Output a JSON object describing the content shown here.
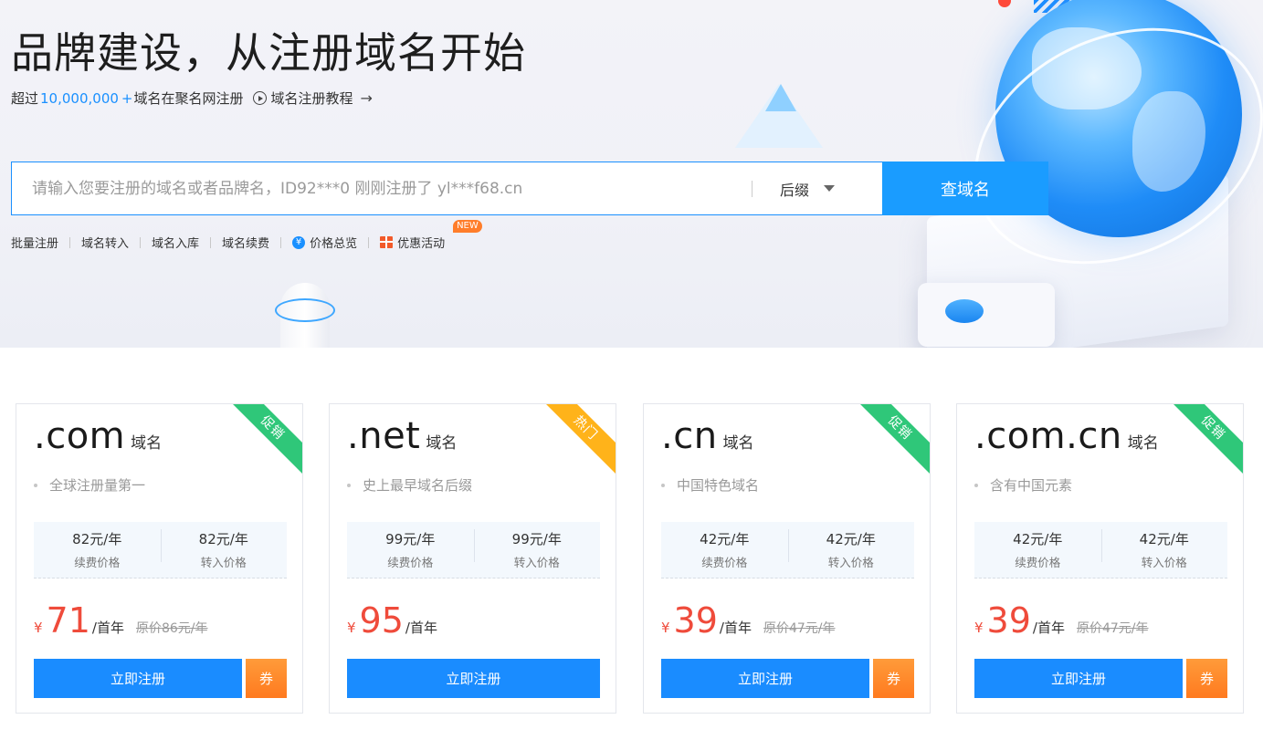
{
  "hero": {
    "title": "品牌建设，从注册域名开始",
    "sub_prefix": "超过",
    "sub_count": "10,000,000",
    "sub_plus": "+",
    "sub_suffix": "域名在聚名网注册",
    "tutorial_label": "域名注册教程",
    "arrow": "→"
  },
  "search": {
    "placeholder": "请输入您要注册的域名或者品牌名，ID92***0 刚刚注册了 yl***f68.cn",
    "suffix_label": "后缀",
    "button_label": "查域名"
  },
  "quick_links": {
    "batch": "批量注册",
    "transfer_in": "域名转入",
    "deposit": "域名入库",
    "renew": "域名续费",
    "price_overview": "价格总览",
    "promotions": "优惠活动",
    "new_badge": "NEW"
  },
  "cards": [
    {
      "ext": ".com",
      "ext_suffix": "域名",
      "ribbon": "促销",
      "ribbon_color": "#2fc779",
      "feature": "全球注册量第一",
      "renew_price": "82元/年",
      "renew_label": "续费价格",
      "transfer_price": "82元/年",
      "transfer_label": "转入价格",
      "yen": "¥",
      "sale_price": "71",
      "sale_unit": "/首年",
      "orig_price": "原价86元/年",
      "register_label": "立即注册",
      "coupon_label": "券"
    },
    {
      "ext": ".net",
      "ext_suffix": "域名",
      "ribbon": "热门",
      "ribbon_color": "#ffb31a",
      "feature": "史上最早域名后缀",
      "renew_price": "99元/年",
      "renew_label": "续费价格",
      "transfer_price": "99元/年",
      "transfer_label": "转入价格",
      "yen": "¥",
      "sale_price": "95",
      "sale_unit": "/首年",
      "orig_price": "",
      "register_label": "立即注册",
      "coupon_label": ""
    },
    {
      "ext": ".cn",
      "ext_suffix": "域名",
      "ribbon": "促销",
      "ribbon_color": "#2fc779",
      "feature": "中国特色域名",
      "renew_price": "42元/年",
      "renew_label": "续费价格",
      "transfer_price": "42元/年",
      "transfer_label": "转入价格",
      "yen": "¥",
      "sale_price": "39",
      "sale_unit": "/首年",
      "orig_price": "原价47元/年",
      "register_label": "立即注册",
      "coupon_label": "券"
    },
    {
      "ext": ".com.cn",
      "ext_suffix": "域名",
      "ribbon": "促销",
      "ribbon_color": "#2fc779",
      "feature": "含有中国元素",
      "renew_price": "42元/年",
      "renew_label": "续费价格",
      "transfer_price": "42元/年",
      "transfer_label": "转入价格",
      "yen": "¥",
      "sale_price": "39",
      "sale_unit": "/首年",
      "orig_price": "原价47元/年",
      "register_label": "立即注册",
      "coupon_label": "券"
    }
  ],
  "colors": {
    "accent": "#1a8cff",
    "price_red": "#ef4b3b",
    "coupon_orange": "#ff7a1f"
  }
}
